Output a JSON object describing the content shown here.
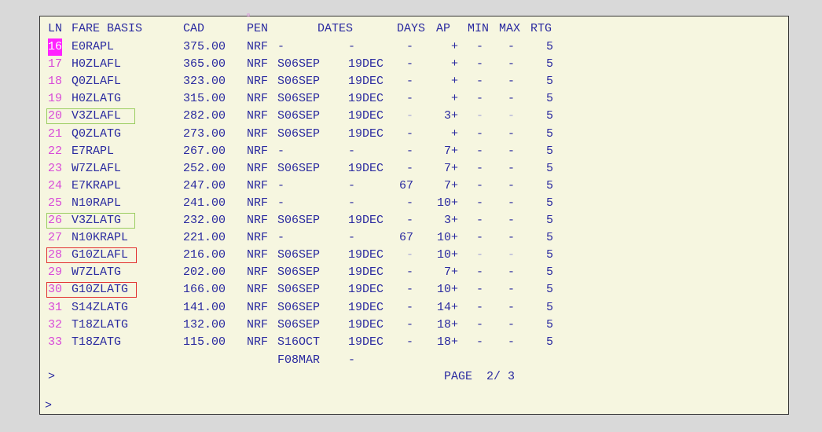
{
  "header": {
    "ln": "LN",
    "fare_basis": "FARE BASIS",
    "cad": "CAD",
    "pen": "PEN",
    "dates": "DATES",
    "days": "DAYS",
    "ap": "AP",
    "min": "MIN",
    "max": "MAX",
    "rtg": "RTG"
  },
  "rows": [
    {
      "ln": "16",
      "basis": "E0RAPL",
      "amount": "375.00",
      "pen": "NRF",
      "date_from": "-",
      "date_to": "-",
      "days": "-",
      "ap": "+",
      "min": "-",
      "max": "-",
      "rtg": "5",
      "selected": true,
      "box": "",
      "dim": false
    },
    {
      "ln": "17",
      "basis": "H0ZLAFL",
      "amount": "365.00",
      "pen": "NRF",
      "date_from": "S06SEP",
      "date_to": "19DEC",
      "days": "-",
      "ap": "+",
      "min": "-",
      "max": "-",
      "rtg": "5",
      "selected": false,
      "box": "",
      "dim": false
    },
    {
      "ln": "18",
      "basis": "Q0ZLAFL",
      "amount": "323.00",
      "pen": "NRF",
      "date_from": "S06SEP",
      "date_to": "19DEC",
      "days": "-",
      "ap": "+",
      "min": "-",
      "max": "-",
      "rtg": "5",
      "selected": false,
      "box": "",
      "dim": false
    },
    {
      "ln": "19",
      "basis": "H0ZLATG",
      "amount": "315.00",
      "pen": "NRF",
      "date_from": "S06SEP",
      "date_to": "19DEC",
      "days": "-",
      "ap": "+",
      "min": "-",
      "max": "-",
      "rtg": "5",
      "selected": false,
      "box": "",
      "dim": false
    },
    {
      "ln": "20",
      "basis": "V3ZLAFL",
      "amount": "282.00",
      "pen": "NRF",
      "date_from": "S06SEP",
      "date_to": "19DEC",
      "days": "-",
      "ap": "3+",
      "min": "-",
      "max": "-",
      "rtg": "5",
      "selected": false,
      "box": "green",
      "dim": true
    },
    {
      "ln": "21",
      "basis": "Q0ZLATG",
      "amount": "273.00",
      "pen": "NRF",
      "date_from": "S06SEP",
      "date_to": "19DEC",
      "days": "-",
      "ap": "+",
      "min": "-",
      "max": "-",
      "rtg": "5",
      "selected": false,
      "box": "",
      "dim": false
    },
    {
      "ln": "22",
      "basis": "E7RAPL",
      "amount": "267.00",
      "pen": "NRF",
      "date_from": "-",
      "date_to": "-",
      "days": "-",
      "ap": "7+",
      "min": "-",
      "max": "-",
      "rtg": "5",
      "selected": false,
      "box": "",
      "dim": false
    },
    {
      "ln": "23",
      "basis": "W7ZLAFL",
      "amount": "252.00",
      "pen": "NRF",
      "date_from": "S06SEP",
      "date_to": "19DEC",
      "days": "-",
      "ap": "7+",
      "min": "-",
      "max": "-",
      "rtg": "5",
      "selected": false,
      "box": "",
      "dim": false
    },
    {
      "ln": "24",
      "basis": "E7KRAPL",
      "amount": "247.00",
      "pen": "NRF",
      "date_from": "-",
      "date_to": "-",
      "days": "67",
      "ap": "7+",
      "min": "-",
      "max": "-",
      "rtg": "5",
      "selected": false,
      "box": "",
      "dim": false
    },
    {
      "ln": "25",
      "basis": "N10RAPL",
      "amount": "241.00",
      "pen": "NRF",
      "date_from": "-",
      "date_to": "-",
      "days": "-",
      "ap": "10+",
      "min": "-",
      "max": "-",
      "rtg": "5",
      "selected": false,
      "box": "",
      "dim": false
    },
    {
      "ln": "26",
      "basis": "V3ZLATG",
      "amount": "232.00",
      "pen": "NRF",
      "date_from": "S06SEP",
      "date_to": "19DEC",
      "days": "-",
      "ap": "3+",
      "min": "-",
      "max": "-",
      "rtg": "5",
      "selected": false,
      "box": "green",
      "dim": false
    },
    {
      "ln": "27",
      "basis": "N10KRAPL",
      "amount": "221.00",
      "pen": "NRF",
      "date_from": "-",
      "date_to": "-",
      "days": "67",
      "ap": "10+",
      "min": "-",
      "max": "-",
      "rtg": "5",
      "selected": false,
      "box": "",
      "dim": false
    },
    {
      "ln": "28",
      "basis": "G10ZLAFL",
      "amount": "216.00",
      "pen": "NRF",
      "date_from": "S06SEP",
      "date_to": "19DEC",
      "days": "-",
      "ap": "10+",
      "min": "-",
      "max": "-",
      "rtg": "5",
      "selected": false,
      "box": "red",
      "dim": true
    },
    {
      "ln": "29",
      "basis": "W7ZLATG",
      "amount": "202.00",
      "pen": "NRF",
      "date_from": "S06SEP",
      "date_to": "19DEC",
      "days": "-",
      "ap": "7+",
      "min": "-",
      "max": "-",
      "rtg": "5",
      "selected": false,
      "box": "",
      "dim": false
    },
    {
      "ln": "30",
      "basis": "G10ZLATG",
      "amount": "166.00",
      "pen": "NRF",
      "date_from": "S06SEP",
      "date_to": "19DEC",
      "days": "-",
      "ap": "10+",
      "min": "-",
      "max": "-",
      "rtg": "5",
      "selected": false,
      "box": "red",
      "dim": false
    },
    {
      "ln": "31",
      "basis": "S14ZLATG",
      "amount": "141.00",
      "pen": "NRF",
      "date_from": "S06SEP",
      "date_to": "19DEC",
      "days": "-",
      "ap": "14+",
      "min": "-",
      "max": "-",
      "rtg": "5",
      "selected": false,
      "box": "",
      "dim": false
    },
    {
      "ln": "32",
      "basis": "T18ZLATG",
      "amount": "132.00",
      "pen": "NRF",
      "date_from": "S06SEP",
      "date_to": "19DEC",
      "days": "-",
      "ap": "18+",
      "min": "-",
      "max": "-",
      "rtg": "5",
      "selected": false,
      "box": "",
      "dim": false
    },
    {
      "ln": "33",
      "basis": "T18ZATG",
      "amount": "115.00",
      "pen": "NRF",
      "date_from": "S16OCT",
      "date_to": "19DEC",
      "days": "-",
      "ap": "18+",
      "min": "-",
      "max": "-",
      "rtg": "5",
      "selected": false,
      "box": "",
      "dim": false
    }
  ],
  "continuation": {
    "date_from": "F08MAR",
    "date_to": "-"
  },
  "prompt1": ">",
  "page_label": "PAGE  2/ 3",
  "prompt2": ">"
}
